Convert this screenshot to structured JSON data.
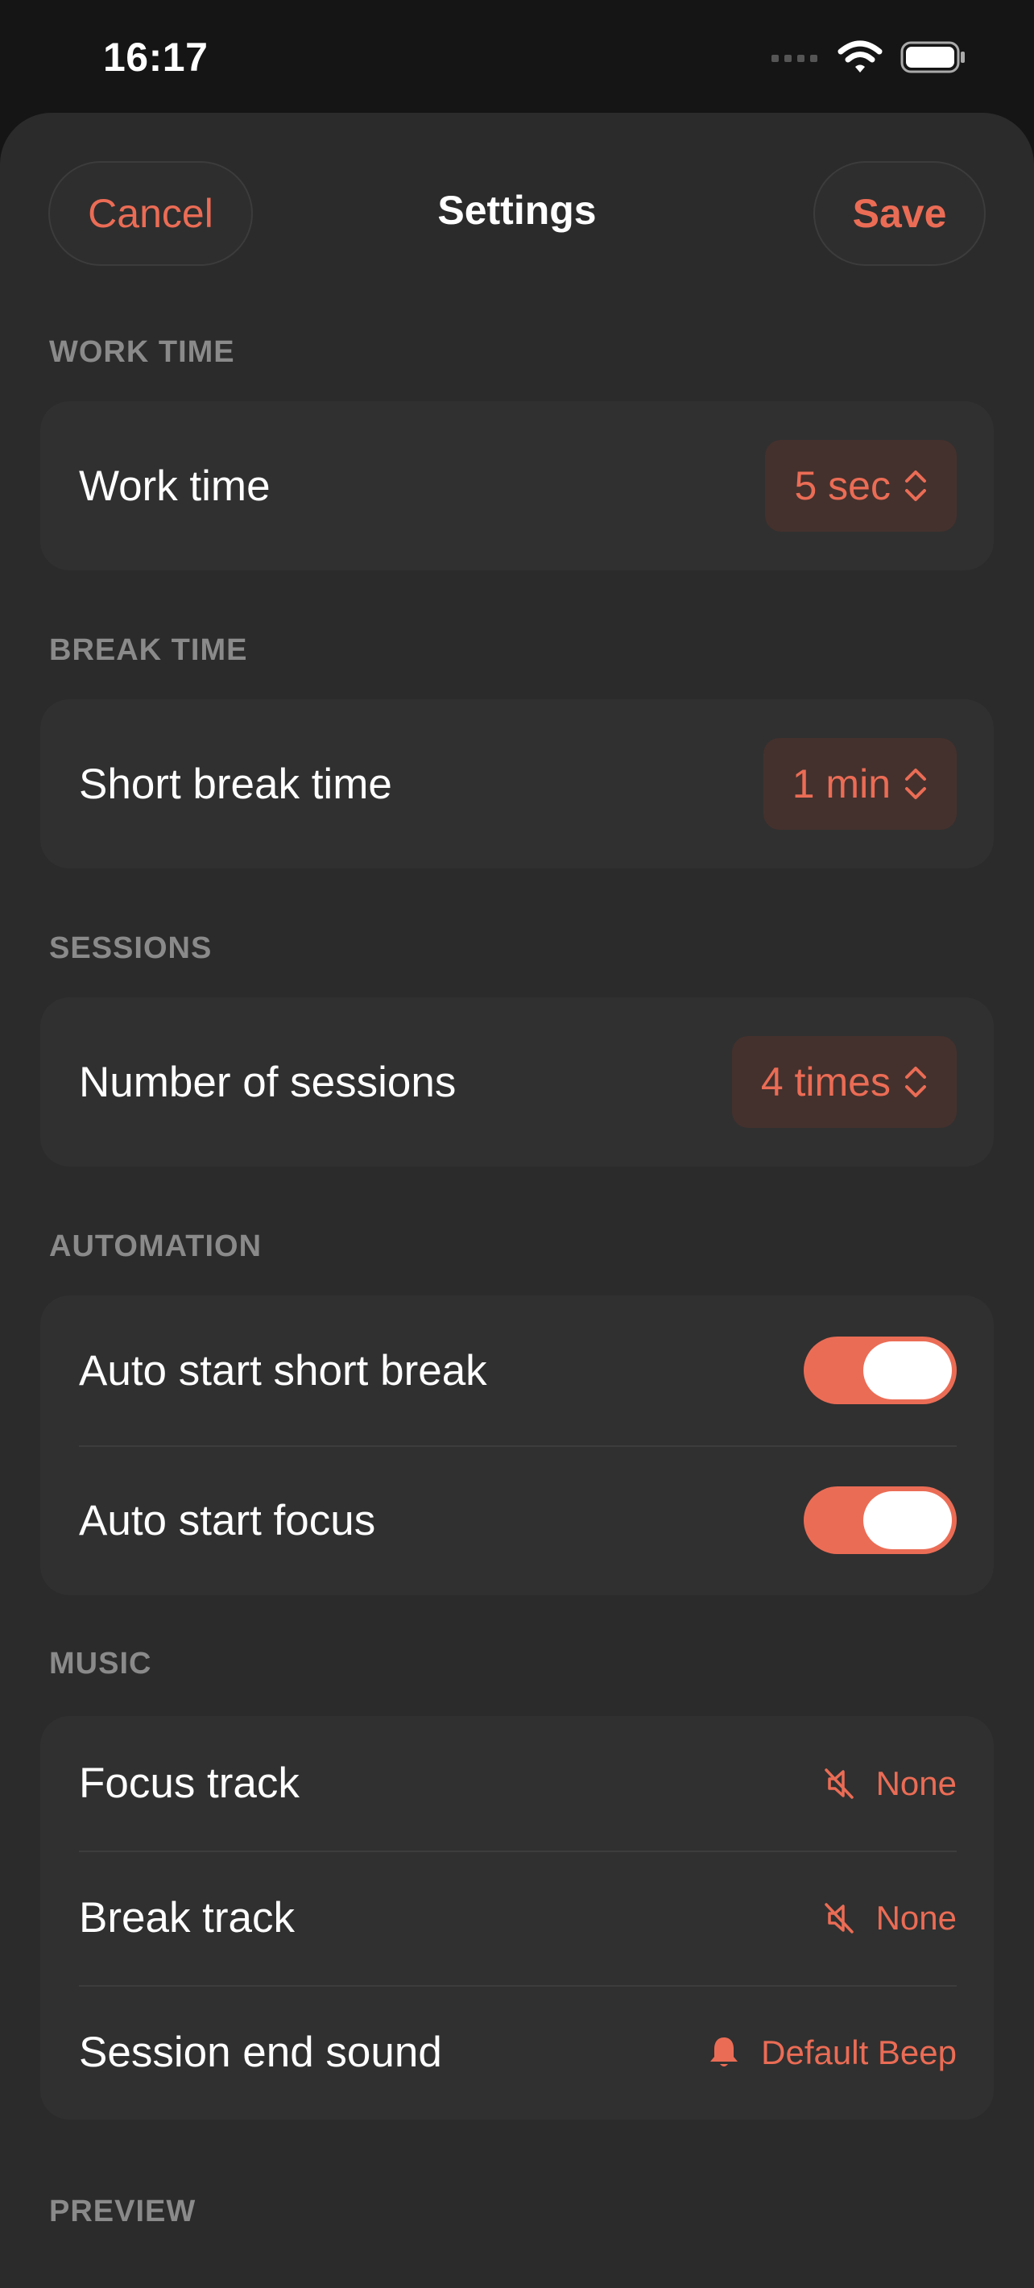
{
  "status_bar": {
    "time": "16:17"
  },
  "nav": {
    "cancel_label": "Cancel",
    "title": "Settings",
    "save_label": "Save"
  },
  "sections": {
    "work_time": {
      "header": "WORK TIME",
      "label": "Work time",
      "value": "5 sec"
    },
    "break_time": {
      "header": "BREAK TIME",
      "label": "Short break time",
      "value": "1 min"
    },
    "sessions": {
      "header": "SESSIONS",
      "label": "Number of sessions",
      "value": "4 times"
    },
    "automation": {
      "header": "AUTOMATION",
      "items": [
        {
          "label": "Auto start short break",
          "on": true
        },
        {
          "label": "Auto start focus",
          "on": true
        }
      ]
    },
    "music": {
      "header": "MUSIC",
      "items": [
        {
          "label": "Focus track",
          "value": "None",
          "icon": "speaker-muted-icon"
        },
        {
          "label": "Break track",
          "value": "None",
          "icon": "speaker-muted-icon"
        },
        {
          "label": "Session end sound",
          "value": "Default Beep",
          "icon": "bell-icon"
        }
      ]
    },
    "preview": {
      "header": "PREVIEW"
    }
  },
  "colors": {
    "accent": "#eb6c55",
    "background": "#2b2b2b",
    "card": "#303030"
  }
}
